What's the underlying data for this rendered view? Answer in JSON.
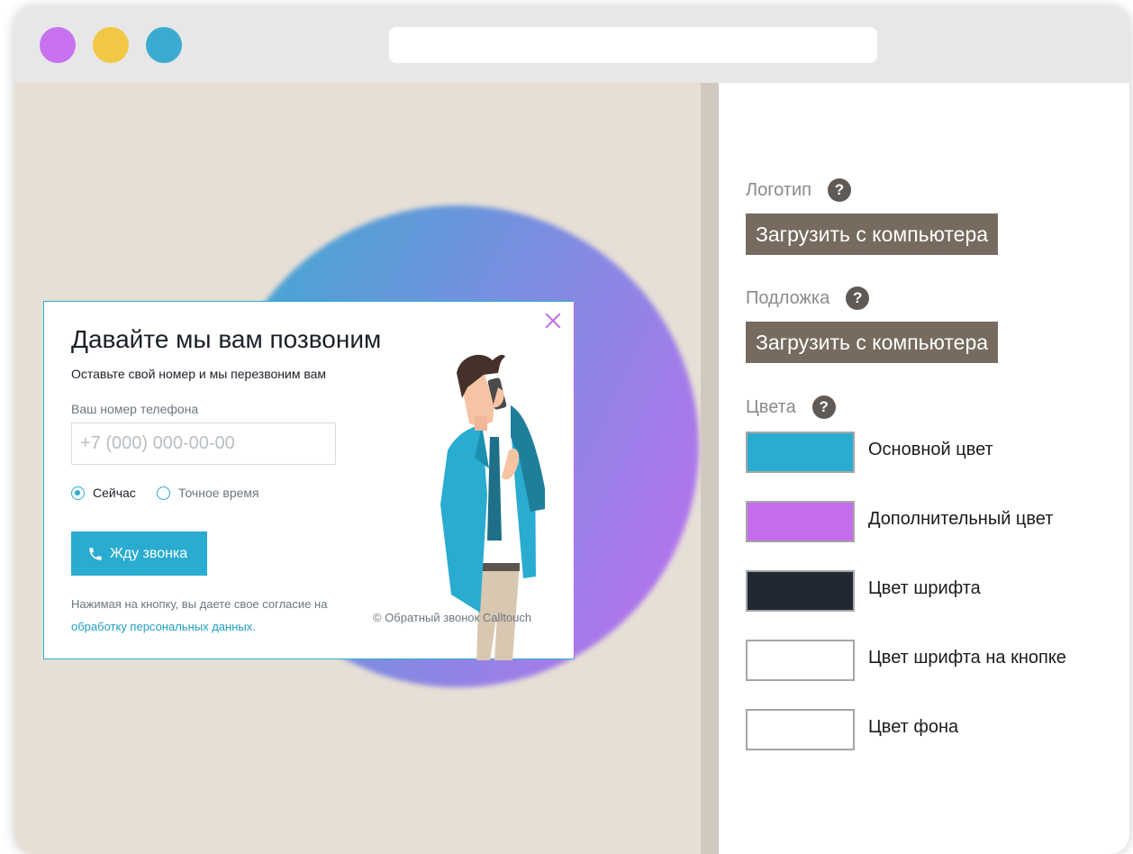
{
  "window": {
    "dot_colors": [
      "#c872ef",
      "#f2c744",
      "#3aabd0"
    ],
    "address": ""
  },
  "canvas": {
    "background": "#e7dfd6",
    "blob_gradient": [
      "#3aabd0",
      "#c06ef0"
    ]
  },
  "popup": {
    "title": "Давайте мы вам позвоним",
    "subtitle": "Оставьте свой номер и мы перезвоним вам",
    "phone_label": "Ваш номер телефона",
    "phone_placeholder": "+7 (000) 000-00-00",
    "radio_now": "Сейчас",
    "radio_exact": "Точное время",
    "selected_radio": "Сейчас",
    "button_label": "Жду звонка",
    "consent_text": "Нажимая на кнопку, вы даете свое согласие на",
    "consent_link": "обработку персональных данных.",
    "copyright": "© Обратный звонок Calltouch",
    "accent_color": "#29acd0",
    "close_color": "#c269e8"
  },
  "settings": {
    "logo_label": "Логотип",
    "logo_upload": "Загрузить с компьютера",
    "backdrop_label": "Подложка",
    "backdrop_upload": "Загрузить с компьютера",
    "colors_label": "Цвета",
    "help_symbol": "?",
    "colors": [
      {
        "name": "Основной цвет",
        "value": "#29acd0"
      },
      {
        "name": "Дополнительный цвет",
        "value": "#c46cec"
      },
      {
        "name": "Цвет шрифта",
        "value": "#222831"
      },
      {
        "name": "Цвет шрифта на кнопке",
        "value": "#ffffff"
      },
      {
        "name": "Цвет фона",
        "value": "#ffffff"
      }
    ]
  }
}
